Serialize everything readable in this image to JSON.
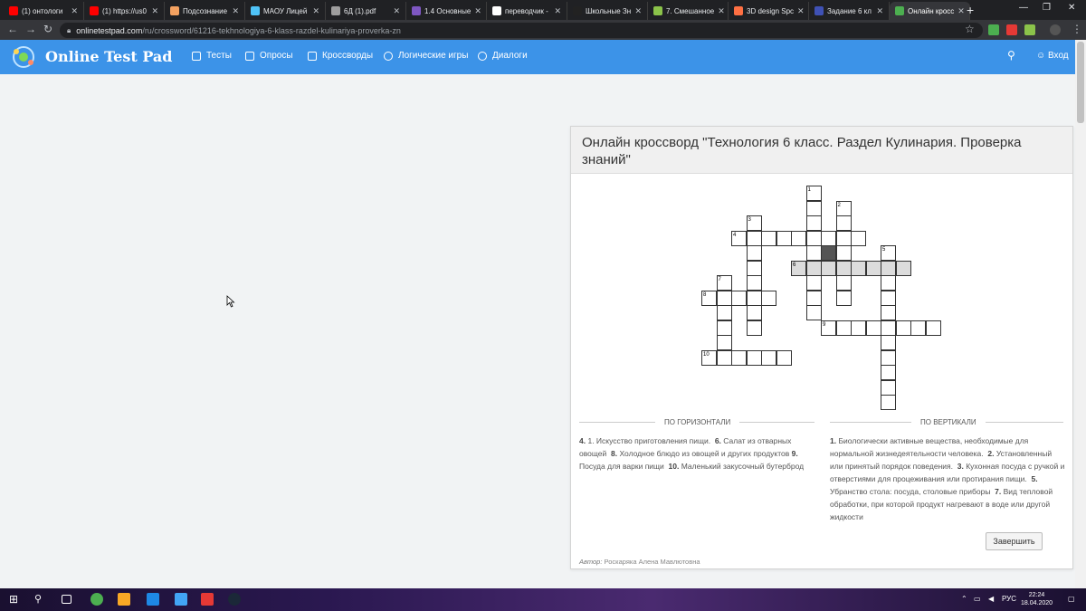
{
  "browser": {
    "tabs": [
      {
        "label": "(1) онтологи",
        "color": "#ff0000"
      },
      {
        "label": "(1) https://us0",
        "color": "#ff0000"
      },
      {
        "label": "Подсознание",
        "color": "#f4a261"
      },
      {
        "label": "МАОУ Лицей",
        "color": "#4fc3f7"
      },
      {
        "label": "6Д (1).pdf",
        "color": "#9e9e9e"
      },
      {
        "label": "1.4 Основные",
        "color": "#7e57c2"
      },
      {
        "label": "переводчик -",
        "color": "#ffffff"
      },
      {
        "label": "Школьные Зн",
        "color": "#222222"
      },
      {
        "label": "7. Смешанное",
        "color": "#8bc34a"
      },
      {
        "label": "3D design Spc",
        "color": "#ff7043"
      },
      {
        "label": "Задание 6 кл",
        "color": "#3f51b5"
      },
      {
        "label": "Онлайн кросс",
        "color": "#4caf50"
      }
    ],
    "url_host": "onlinetestpad.com",
    "url_path": "/ru/crossword/61216-tekhnologiya-6-klass-razdel-kulinariya-proverka-zn"
  },
  "site": {
    "logo": "Online Test Pad",
    "nav": [
      "Тесты",
      "Опросы",
      "Кроссворды",
      "Логические игры",
      "Диалоги"
    ],
    "login": "Вход"
  },
  "crossword": {
    "title": "Онлайн кроссворд \"Технология 6 класс. Раздел Кулинария. Проверка знаний\"",
    "across_header": "ПО ГОРИЗОНТАЛИ",
    "down_header": "ПО ВЕРТИКАЛИ",
    "across": [
      {
        "n": "4.",
        "t": "1. Искусство приготовления пищи."
      },
      {
        "n": "6.",
        "t": "Салат из отварных овощей"
      },
      {
        "n": "8.",
        "t": "Холодное блюдо из овощей и других продуктов"
      },
      {
        "n": "9.",
        "t": "Посуда для варки пищи"
      },
      {
        "n": "10.",
        "t": "Маленький закусочный бутерброд"
      }
    ],
    "down": [
      {
        "n": "1.",
        "t": "Биологически активные вещества, необходимые для нормальной жизнедеятельности человека."
      },
      {
        "n": "2.",
        "t": "Установленный или принятый порядок поведения."
      },
      {
        "n": "3.",
        "t": "Кухонная посуда с ручкой и отверстиями для процеживания или протирания пищи."
      },
      {
        "n": "5.",
        "t": "Убранство стола: посуда, столовые приборы"
      },
      {
        "n": "7.",
        "t": "Вид тепловой обработки, при которой продукт нагревают в воде или другой жидкости"
      }
    ],
    "finish": "Завершить",
    "author_label": "Автор:",
    "author": "Роскаряка Алена Мавлютовна"
  },
  "taskbar": {
    "lang": "РУС",
    "time": "22:24",
    "date": "18.04.2020"
  }
}
